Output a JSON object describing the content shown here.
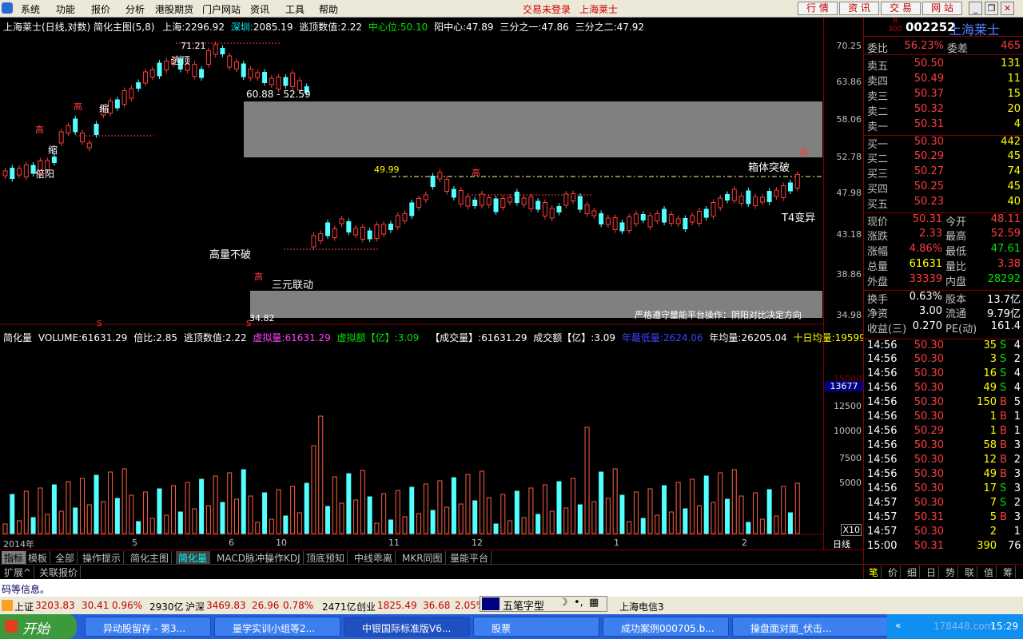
{
  "menubar": {
    "items": [
      "系统",
      "功能",
      "报价",
      "分析",
      "港股期货",
      "门户网站",
      "资讯",
      "工具",
      "帮助"
    ],
    "status_login": "交易未登录",
    "status_stock": "上海莱士",
    "buttons": [
      "行 情",
      "资 讯",
      "交 易",
      "网 站"
    ]
  },
  "chart": {
    "title_line": "上海莱士(日线,对数) 简化主图(5,8)",
    "sh_label": "上海:",
    "sh_val": "2296.92",
    "sz_label": "深圳:",
    "sz_val": "2085.19",
    "escape_label": "逃顶数值:",
    "escape_val": "2.22",
    "center_label": "中心位:",
    "center_val": "50.10",
    "yang_label": "阳中心:",
    "yang_val": "47.89",
    "third1_label": "三分之一:",
    "third1_val": "47.86",
    "third2_label": "三分之二:",
    "third2_val": "47.92",
    "annotations": {
      "high_7121": "71.21",
      "escape_top": "逃顶",
      "range_box": "60.88 - 52.59",
      "beiyang": "倍阳",
      "suo": "缩",
      "gao": "高",
      "v4999": "49.99",
      "box_break": "箱体突破",
      "t4": "T4变异",
      "high_no_break": "高量不破",
      "three_link": "三元联动",
      "low_3482": "34.82",
      "platform_note": "严格遵守量能平台操作：阴阳对比决定方向",
      "s_mark": "S"
    },
    "y_ticks": [
      "70.25",
      "63.86",
      "58.06",
      "52.78",
      "47.98",
      "43.18",
      "38.86",
      "34.98"
    ],
    "x_labels": [
      "2014年",
      "5",
      "6",
      "10",
      "11",
      "12",
      "1",
      "2"
    ],
    "period": "日线"
  },
  "volume": {
    "header_name": "简化量",
    "vol_label": "VOLUME:",
    "vol_val": "61631.29",
    "ratio_label": "倍比:",
    "ratio_val": "2.85",
    "esc_label": "逃顶数值:",
    "esc_val": "2.22",
    "virtual_label": "虚拟量:",
    "virtual_val": "61631.29",
    "virtual_amt_label": "虚拟额【亿】:",
    "virtual_amt_val": "3.09",
    "deal_label": "【成交量】:",
    "deal_val": "61631.29",
    "deal_amt_label": "成交额【亿】:",
    "deal_amt_val": "3.09",
    "year_low_label": "年最低量:",
    "year_low_val": "2624.06",
    "year_avg_label": "年均量:",
    "year_avg_val": "26205.04",
    "ten_avg_label": "十日均量:",
    "ten_avg_val": "19599",
    "y_ticks": [
      "15000",
      "12500",
      "10000",
      "7500",
      "5000"
    ],
    "current_tag": "13677",
    "unit": "X10",
    "bei": "倍"
  },
  "quote": {
    "code": "002252",
    "name": "上海莱士",
    "badge_r": "R",
    "badge_num": "300",
    "weibi_label": "委比",
    "weibi_val": "56.23%",
    "weicha_label": "委差",
    "weicha_val": "465",
    "asks": [
      {
        "label": "卖五",
        "price": "50.50",
        "vol": "131"
      },
      {
        "label": "卖四",
        "price": "50.49",
        "vol": "11"
      },
      {
        "label": "卖三",
        "price": "50.37",
        "vol": "15"
      },
      {
        "label": "卖二",
        "price": "50.32",
        "vol": "20"
      },
      {
        "label": "卖一",
        "price": "50.31",
        "vol": "4"
      }
    ],
    "bids": [
      {
        "label": "买一",
        "price": "50.30",
        "vol": "442"
      },
      {
        "label": "买二",
        "price": "50.29",
        "vol": "45"
      },
      {
        "label": "买三",
        "price": "50.27",
        "vol": "74"
      },
      {
        "label": "买四",
        "price": "50.25",
        "vol": "45"
      },
      {
        "label": "买五",
        "price": "50.23",
        "vol": "40"
      }
    ],
    "stats": [
      {
        "l1": "现价",
        "v1": "50.31",
        "l2": "今开",
        "v2": "48.11"
      },
      {
        "l1": "涨跌",
        "v1": "2.33",
        "l2": "最高",
        "v2": "52.59"
      },
      {
        "l1": "涨幅",
        "v1": "4.86%",
        "l2": "最低",
        "v2": "47.61"
      },
      {
        "l1": "总量",
        "v1": "61631",
        "l2": "量比",
        "v2": "3.38"
      },
      {
        "l1": "外盘",
        "v1": "33339",
        "l2": "内盘",
        "v2": "28292"
      }
    ],
    "stats2": [
      {
        "l1": "换手",
        "v1": "0.63%",
        "l2": "股本",
        "v2": "13.7亿"
      },
      {
        "l1": "净资",
        "v1": "3.00",
        "l2": "流通",
        "v2": "9.79亿"
      },
      {
        "l1": "收益(三)",
        "v1": "0.270",
        "l2": "PE(动)",
        "v2": "161.4"
      }
    ],
    "ticks": [
      {
        "t": "14:56",
        "p": "50.30",
        "v": "35",
        "bs": "S",
        "n": "4"
      },
      {
        "t": "14:56",
        "p": "50.30",
        "v": "3",
        "bs": "S",
        "n": "2"
      },
      {
        "t": "14:56",
        "p": "50.30",
        "v": "16",
        "bs": "S",
        "n": "4"
      },
      {
        "t": "14:56",
        "p": "50.30",
        "v": "49",
        "bs": "S",
        "n": "4"
      },
      {
        "t": "14:56",
        "p": "50.30",
        "v": "150",
        "bs": "B",
        "n": "5"
      },
      {
        "t": "14:56",
        "p": "50.30",
        "v": "1",
        "bs": "B",
        "n": "1"
      },
      {
        "t": "14:56",
        "p": "50.29",
        "v": "1",
        "bs": "B",
        "n": "1"
      },
      {
        "t": "14:56",
        "p": "50.30",
        "v": "58",
        "bs": "B",
        "n": "3"
      },
      {
        "t": "14:56",
        "p": "50.30",
        "v": "12",
        "bs": "B",
        "n": "2"
      },
      {
        "t": "14:56",
        "p": "50.30",
        "v": "49",
        "bs": "B",
        "n": "3"
      },
      {
        "t": "14:56",
        "p": "50.30",
        "v": "17",
        "bs": "S",
        "n": "3"
      },
      {
        "t": "14:57",
        "p": "50.30",
        "v": "7",
        "bs": "S",
        "n": "2"
      },
      {
        "t": "14:57",
        "p": "50.31",
        "v": "5",
        "bs": "B",
        "n": "3"
      },
      {
        "t": "14:57",
        "p": "50.30",
        "v": "2",
        "bs": "",
        "n": "1"
      },
      {
        "t": "15:00",
        "p": "50.31",
        "v": "390",
        "bs": "",
        "n": "76"
      }
    ],
    "side_tabs": [
      "笔",
      "价",
      "细",
      "日",
      "势",
      "联",
      "值",
      "筹"
    ]
  },
  "tabs": [
    "指标",
    "模板",
    "全部",
    "操作提示",
    "简化主图",
    "简化量",
    "MACD脉冲",
    "操作KDJ",
    "顶底预知",
    "中线乖离",
    "MKR同图",
    "量能平台"
  ],
  "tabs2": [
    "扩展^",
    "关联报价"
  ],
  "msg": "码等信息。",
  "indexbar": {
    "sh_name": "上证",
    "sh_val": "3203.83",
    "sh_chg": "30.41",
    "sh_pct": "0.96%",
    "sh_amt": "2930亿",
    "hs_name": "沪深",
    "hs_val": "3469.83",
    "hs_chg": "26.96",
    "hs_pct": "0.78%",
    "hs_amt": "2471亿",
    "cy_name": "创业",
    "cy_val": "1825.49",
    "cy_chg": "36.68",
    "cy_pct": "2.05%",
    "telecom": "上海电信3"
  },
  "ime": {
    "label": "五笔字型"
  },
  "taskbar": {
    "start": "开始",
    "tasks": [
      "异动股留存 - 第3...",
      "量学实训小组等2...",
      "中银国际标准版V6...",
      "股票",
      "成功案例000705.b...",
      "操盘面对面_伏击..."
    ],
    "time": "15:29",
    "watermark": "178448.com"
  },
  "colors": {
    "up": "#ff3c3c",
    "down": "#54ffff",
    "bg": "#000000",
    "grid": "#800000",
    "gray_box": "#808080"
  }
}
